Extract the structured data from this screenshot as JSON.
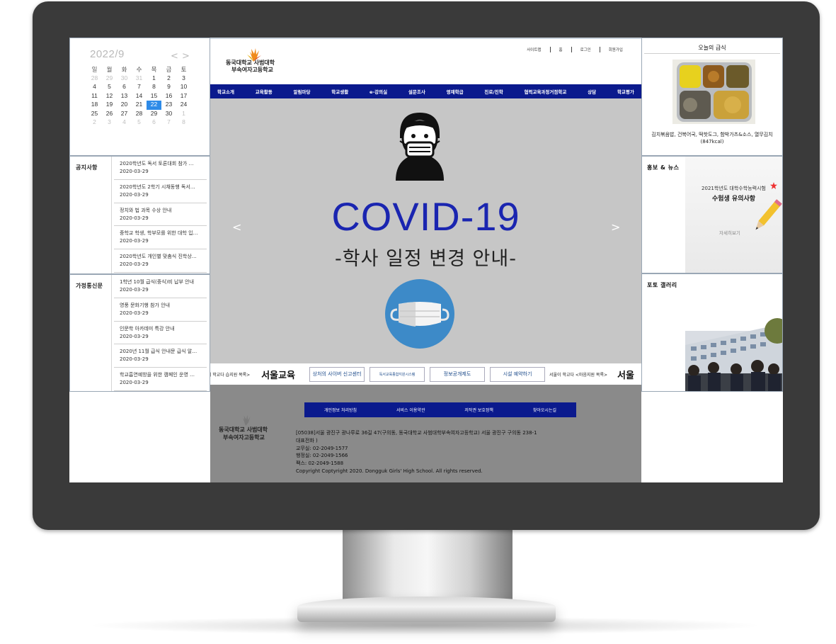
{
  "calendar": {
    "title": "2022/9",
    "prev": "<",
    "next": ">",
    "weekdays": [
      "일",
      "월",
      "화",
      "수",
      "목",
      "금",
      "토"
    ],
    "weeks": [
      [
        "28",
        "29",
        "30",
        "31",
        "1",
        "2",
        "3"
      ],
      [
        "4",
        "5",
        "6",
        "7",
        "8",
        "9",
        "10"
      ],
      [
        "11",
        "12",
        "13",
        "14",
        "15",
        "16",
        "17"
      ],
      [
        "18",
        "19",
        "20",
        "21",
        "22",
        "23",
        "24"
      ],
      [
        "25",
        "26",
        "27",
        "28",
        "29",
        "30",
        "1"
      ],
      [
        "2",
        "3",
        "4",
        "5",
        "6",
        "7",
        "8"
      ]
    ],
    "today": "22"
  },
  "notice": {
    "title": "공지사항",
    "items": [
      {
        "title": "2020학년도 독서 토론대회 참가 …",
        "date": "2020-03-29"
      },
      {
        "title": "2020학년도 2학기 시채동행 독서…",
        "date": "2020-03-29"
      },
      {
        "title": "정치와 법 과목 수상 안내",
        "date": "2020-03-29"
      },
      {
        "title": "중학교 학생, 학부모를 위한 대학 입…",
        "date": "2020-03-29"
      },
      {
        "title": "2020학년도 개인별 맞춤식 진학상…",
        "date": "2020-03-29"
      }
    ]
  },
  "newsletter": {
    "title": "가정통신문",
    "items": [
      {
        "title": "1학년 10월 급식(중식)비 납부 안내",
        "date": "2020-03-29"
      },
      {
        "title": "영풍 문화기행 참가 안내",
        "date": "2020-03-29"
      },
      {
        "title": "인문학 아카데미 특강 안내",
        "date": "2020-03-29"
      },
      {
        "title": "2020년 11월 급식 안내문 급식 알…",
        "date": "2020-03-29"
      },
      {
        "title": "학교흡연예방을 위한 캠페인 운영 …",
        "date": "2020-03-29"
      }
    ]
  },
  "header": {
    "logo_line1": "동국대학교 사범대학",
    "logo_line2": "부속여자고등학교",
    "util_links": [
      "사이트맵",
      "홈",
      "로그인",
      "회원가입"
    ]
  },
  "gnb": [
    "학교소개",
    "교육활동",
    "알림마당",
    "학교생활",
    "e-강의실",
    "설문조사",
    "영재학급",
    "진로/진학",
    "협력교육과정거점학교",
    "상담",
    "학교평가"
  ],
  "visual": {
    "prev": "<",
    "next": ">",
    "title": "COVID-19",
    "subtitle": "-학사 일정 변경 안내-"
  },
  "banners": [
    "이 학교다 습지원 목록>",
    "서울교육",
    "상처의 사이버 신고센터",
    "독서교육종합지원시스템",
    "정보공개제도",
    "시설 예약하기",
    "서울이 학교다 <마음지원 목록>",
    "서울"
  ],
  "footer": {
    "links": [
      "개인정보 처리방침",
      "서비스 이용약관",
      "저작권 보호정책",
      "찾아오시는길"
    ],
    "logo_line1": "동국대학교 사범대학",
    "logo_line2": "부속여자고등학교",
    "address": [
      "[05038]서울 광진구 광나루로 36길 47(구의동, 동국대학교 사범대학부속여자고등학교) 서울 광진구 구의동 238-1",
      "대표전화 )",
      "교무실: 02-2049-1577",
      "행정실: 02-2049-1566",
      "팩스: 02-2049-1588",
      "Copyright Coptyright 2020. Dongguk Girls' High School. All rights reserved."
    ]
  },
  "meal": {
    "title": "오늘의 급식",
    "menu": "김치볶음밥, 건복어국, 떡핫도그, 함박가츠&소스, 열무김치",
    "kcal": "(847kcal)"
  },
  "promo": {
    "title": "홍보 & 뉴스",
    "card_line1": "2021학년도 대학수학능력시험",
    "card_line2": "수험생 유의사항",
    "card_more": "자세히보기"
  },
  "gallery": {
    "title": "포토 갤러리"
  },
  "colors": {
    "nav": "#0b1a8d",
    "covid_title": "#1a25b0",
    "today": "#2e8be8",
    "footer_bg": "#8a8a8a"
  }
}
